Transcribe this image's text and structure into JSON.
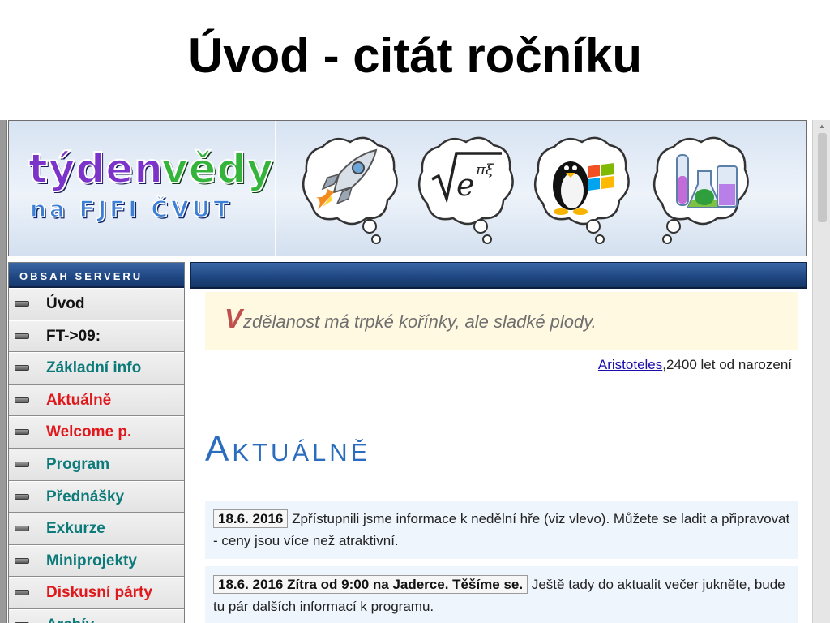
{
  "title": "Úvod - citát ročníku",
  "banner": {
    "logo_line1a": "týden",
    "logo_line1b": "vědy",
    "logo_line2": "na FJFI ČVUT"
  },
  "sidebar": {
    "header": "OBSAH SERVERU",
    "items": [
      {
        "label": "Úvod",
        "color": "#111111"
      },
      {
        "label": "FT->09:",
        "color": "#111111"
      },
      {
        "label": "Základní info",
        "color": "#0d7a7a"
      },
      {
        "label": "Aktuálně",
        "color": "#e0171b"
      },
      {
        "label": "Welcome p.",
        "color": "#e0171b"
      },
      {
        "label": "Program",
        "color": "#0d7a7a"
      },
      {
        "label": "Přednášky",
        "color": "#0d7a7a"
      },
      {
        "label": "Exkurze",
        "color": "#0d7a7a"
      },
      {
        "label": "Miniprojekty",
        "color": "#0d7a7a"
      },
      {
        "label": "Diskusní párty",
        "color": "#e0171b"
      },
      {
        "label": "Archív",
        "color": "#0d7a7a"
      }
    ]
  },
  "quote": {
    "initial": "V",
    "rest": "zdělanost má trpké kořínky, ale sladké plody.",
    "author": "Aristoteles",
    "attribution_suffix": ",2400 let od narození"
  },
  "section": {
    "title_initial": "A",
    "title_rest": "KTUÁLNĚ"
  },
  "news": [
    {
      "date": "18.6. 2016",
      "text": " Zpřístupnili jsme informace k nedělní hře (viz vlevo). Můžete se ladit a připravovat - ceny jsou více než atraktivní."
    },
    {
      "date": "18.6. 2016 Zítra od 9:00 na Jaderce. Těšíme se.",
      "text": " Ještě tady do aktualit večer jukněte, bude tu pár dalších informací k programu."
    }
  ],
  "icons": [
    "rocket-icon",
    "math-formula-icon",
    "penguin-windows-icon",
    "chemistry-flasks-icon",
    "menu-bullet-icon",
    "scroll-up-arrow-icon"
  ],
  "colors": {
    "accent_blue": "#2a6cbd",
    "nav_dark_blue": "#1f4682",
    "quote_bg": "#fff9e1",
    "news_bg": "#eef5fd"
  }
}
